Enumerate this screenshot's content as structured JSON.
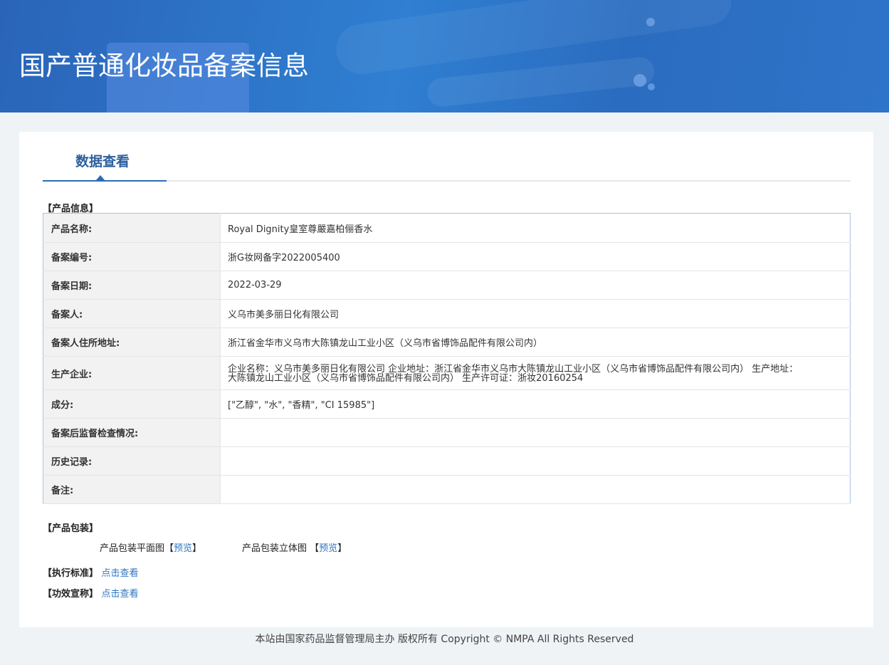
{
  "header": {
    "title": "国产普通化妆品备案信息"
  },
  "tabs": [
    {
      "label": "数据查看",
      "active": true
    }
  ],
  "product_info": {
    "section_label": "【产品信息】",
    "rows": [
      {
        "label": "产品名称:",
        "value": "Royal Dignity皇室尊嚴嘉柏俪香水"
      },
      {
        "label": "备案编号:",
        "value": "浙G妆网备字2022005400"
      },
      {
        "label": "备案日期:",
        "value": "2022-03-29"
      },
      {
        "label": "备案人:",
        "value": "义乌市美多丽日化有限公司"
      },
      {
        "label": "备案人住所地址:",
        "value": "浙江省金华市义乌市大陈镇龙山工业小区（义乌市省博饰品配件有限公司内）"
      },
      {
        "label": "生产企业:",
        "value": "企业名称：义乌市美多丽日化有限公司 企业地址：浙江省金华市义乌市大陈镇龙山工业小区（义乌市省博饰品配件有限公司内） 生产地址：大陈镇龙山工业小区（义乌市省博饰品配件有限公司内） 生产许可证：浙妆20160254"
      },
      {
        "label": "成分:",
        "value": "[\"乙醇\", \"水\", \"香精\", \"CI 15985\"]"
      },
      {
        "label": "备案后监督检查情况:",
        "value": ""
      },
      {
        "label": "历史记录:",
        "value": ""
      },
      {
        "label": "备注:",
        "value": ""
      }
    ]
  },
  "packaging": {
    "section_label": "【产品包装】",
    "flat_label": "产品包装平面图",
    "flat_link": "预览",
    "stereo_label": "产品包装立体图",
    "stereo_link": "预览",
    "bracket_open": "【",
    "bracket_close": "】"
  },
  "standard": {
    "label": "【执行标准】",
    "link": "点击查看"
  },
  "efficacy": {
    "label": "【功效宣称】",
    "link": "点击查看"
  },
  "footer": {
    "text": "本站由国家药品监督管理局主办 版权所有 Copyright © NMPA All Rights Reserved"
  }
}
